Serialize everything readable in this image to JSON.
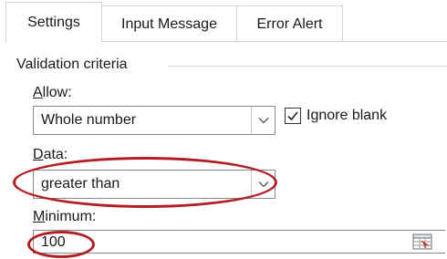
{
  "tabs": [
    {
      "label": "Settings"
    },
    {
      "label": "Input Message"
    },
    {
      "label": "Error Alert"
    }
  ],
  "group": {
    "label": "Validation criteria"
  },
  "allow": {
    "label_key": "A",
    "label_rest": "llow:",
    "value": "Whole number"
  },
  "ignore_blank": {
    "checked": true,
    "label_pre": "Ignore ",
    "label_key": "b",
    "label_rest": "lank"
  },
  "data_field": {
    "label_key": "D",
    "label_rest": "ata:",
    "value": "greater than"
  },
  "minimum": {
    "label_key": "M",
    "label_rest": "inimum:",
    "value": "100"
  },
  "colors": {
    "highlight": "#b11f24",
    "border": "#8a8a8a"
  },
  "icons": [
    "chevron-down-icon",
    "checkmark-icon",
    "range-selector-icon"
  ]
}
